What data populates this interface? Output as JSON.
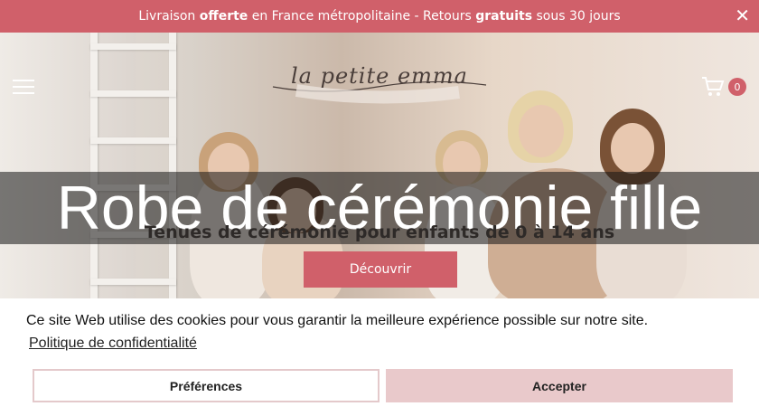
{
  "announcement": {
    "part1": "Livraison ",
    "bold1": "offerte",
    "part2": " en France métropolitaine - Retours ",
    "bold2": "gratuits",
    "part3": " sous 30 jours",
    "close_glyph": "✕"
  },
  "header": {
    "logo_text": "la petite emma",
    "cart_count": "0",
    "menu_icon": "hamburger-menu-icon",
    "cart_icon": "shopping-cart-icon"
  },
  "hero": {
    "title": "Robe de cérémonie fille",
    "subtitle": "Tenues de cérémonie pour enfants de 0 à 14 ans",
    "cta_label": "Découvrir"
  },
  "cookie_banner": {
    "message": "Ce site Web utilise des cookies pour vous garantir la meilleure expérience possible sur notre site.",
    "policy_link": "Politique de confidentialité",
    "preferences_label": "Préférences",
    "accept_label": "Accepter"
  },
  "colors": {
    "accent": "#d0606a",
    "accept_button": "#e9c9cb"
  }
}
